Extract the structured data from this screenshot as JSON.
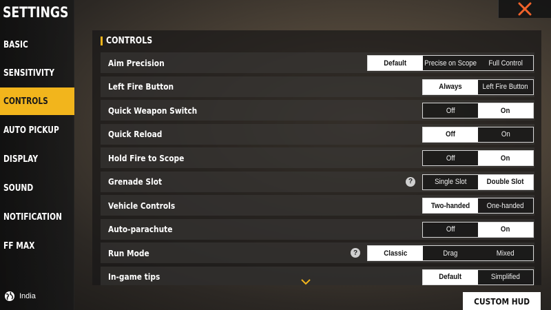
{
  "sidebar": {
    "title": "SETTINGS",
    "items": [
      {
        "label": "BASIC",
        "active": false
      },
      {
        "label": "SENSITIVITY",
        "active": false
      },
      {
        "label": "CONTROLS",
        "active": true
      },
      {
        "label": "AUTO PICKUP",
        "active": false
      },
      {
        "label": "DISPLAY",
        "active": false
      },
      {
        "label": "SOUND",
        "active": false
      },
      {
        "label": "NOTIFICATION",
        "active": false
      },
      {
        "label": "FF MAX",
        "active": false
      }
    ],
    "region": "India"
  },
  "panel": {
    "header": "CONTROLS",
    "rows": [
      {
        "label": "Aim Precision",
        "options": [
          "Default",
          "Precise on Scope",
          "Full Control"
        ],
        "selected": 0,
        "help": false
      },
      {
        "label": "Left Fire Button",
        "options": [
          "Always",
          "Left Fire Button"
        ],
        "selected": 0,
        "help": false
      },
      {
        "label": "Quick Weapon Switch",
        "options": [
          "Off",
          "On"
        ],
        "selected": 1,
        "help": false
      },
      {
        "label": "Quick Reload",
        "options": [
          "Off",
          "On"
        ],
        "selected": 0,
        "help": false
      },
      {
        "label": "Hold Fire to Scope",
        "options": [
          "Off",
          "On"
        ],
        "selected": 1,
        "help": false
      },
      {
        "label": "Grenade Slot",
        "options": [
          "Single Slot",
          "Double Slot"
        ],
        "selected": 1,
        "help": true
      },
      {
        "label": "Vehicle Controls",
        "options": [
          "Two-handed",
          "One-handed"
        ],
        "selected": 0,
        "help": false
      },
      {
        "label": "Auto-parachute",
        "options": [
          "Off",
          "On"
        ],
        "selected": 1,
        "help": false
      },
      {
        "label": "Run Mode",
        "options": [
          "Classic",
          "Drag",
          "Mixed"
        ],
        "selected": 0,
        "help": true
      },
      {
        "label": "In-game tips",
        "options": [
          "Default",
          "Simplified"
        ],
        "selected": 0,
        "help": false
      }
    ]
  },
  "footer": {
    "custom_hud_label": "CUSTOM HUD"
  },
  "icons": {
    "close": "close-icon",
    "help": "help-icon",
    "globe": "globe-icon",
    "scroll_down": "chevron-down-icon"
  },
  "colors": {
    "accent": "#f2b51c",
    "close_x": "#f0622a"
  }
}
